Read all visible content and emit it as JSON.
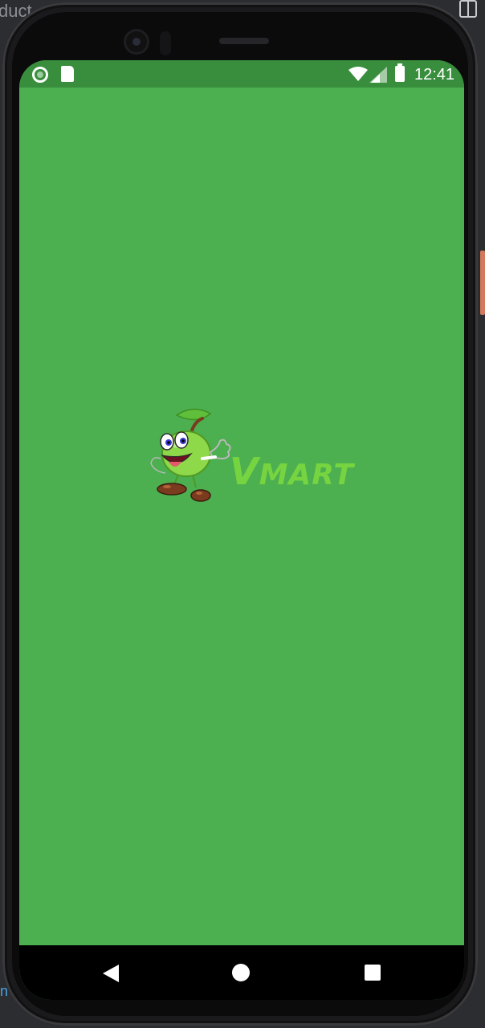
{
  "ide": {
    "partial_text": "duct",
    "split_icon": "split-view-icon"
  },
  "status_bar": {
    "time": "12:41",
    "icons": [
      "notification-circle-icon",
      "sd-card-icon",
      "wifi-icon",
      "signal-icon",
      "battery-icon"
    ]
  },
  "splash": {
    "background_color": "#4caf50",
    "status_bar_color": "#388e3c",
    "logo": {
      "mascot": "apple-mascot",
      "text_v": "V",
      "text_rest": "MART",
      "color": "#76d440"
    }
  },
  "nav_bar": {
    "icons": [
      "back-icon",
      "home-icon",
      "recents-icon"
    ]
  }
}
